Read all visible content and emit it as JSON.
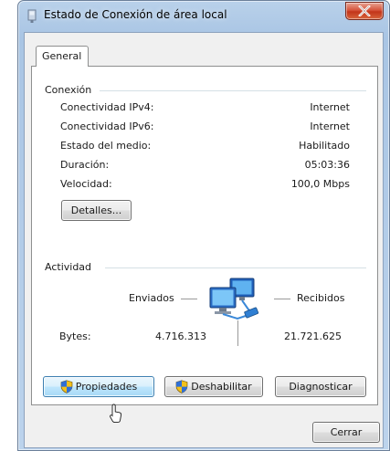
{
  "window": {
    "title": "Estado de Conexión de área local"
  },
  "tabs": [
    {
      "label": "General"
    }
  ],
  "connection": {
    "group_label": "Conexión",
    "rows": [
      {
        "label": "Conectividad IPv4:",
        "value": "Internet"
      },
      {
        "label": "Conectividad IPv6:",
        "value": "Internet"
      },
      {
        "label": "Estado del medio:",
        "value": "Habilitado"
      },
      {
        "label": "Duración:",
        "value": "05:03:36"
      },
      {
        "label": "Velocidad:",
        "value": "100,0 Mbps"
      }
    ],
    "details_button": "Detalles..."
  },
  "activity": {
    "group_label": "Actividad",
    "sent_label": "Enviados",
    "received_label": "Recibidos",
    "bytes_label": "Bytes:",
    "bytes_sent": "4.716.313",
    "bytes_received": "21.721.625"
  },
  "actions": {
    "properties": "Propiedades",
    "disable": "Deshabilitar",
    "diagnose": "Diagnosticar"
  },
  "footer": {
    "close": "Cerrar"
  },
  "colors": {
    "window_frame": "#b9d1ea",
    "close_button": "#c7432a",
    "focused_button": "#bee6fd",
    "shield_blue": "#2f6fd6",
    "shield_yellow": "#f3c11b"
  }
}
